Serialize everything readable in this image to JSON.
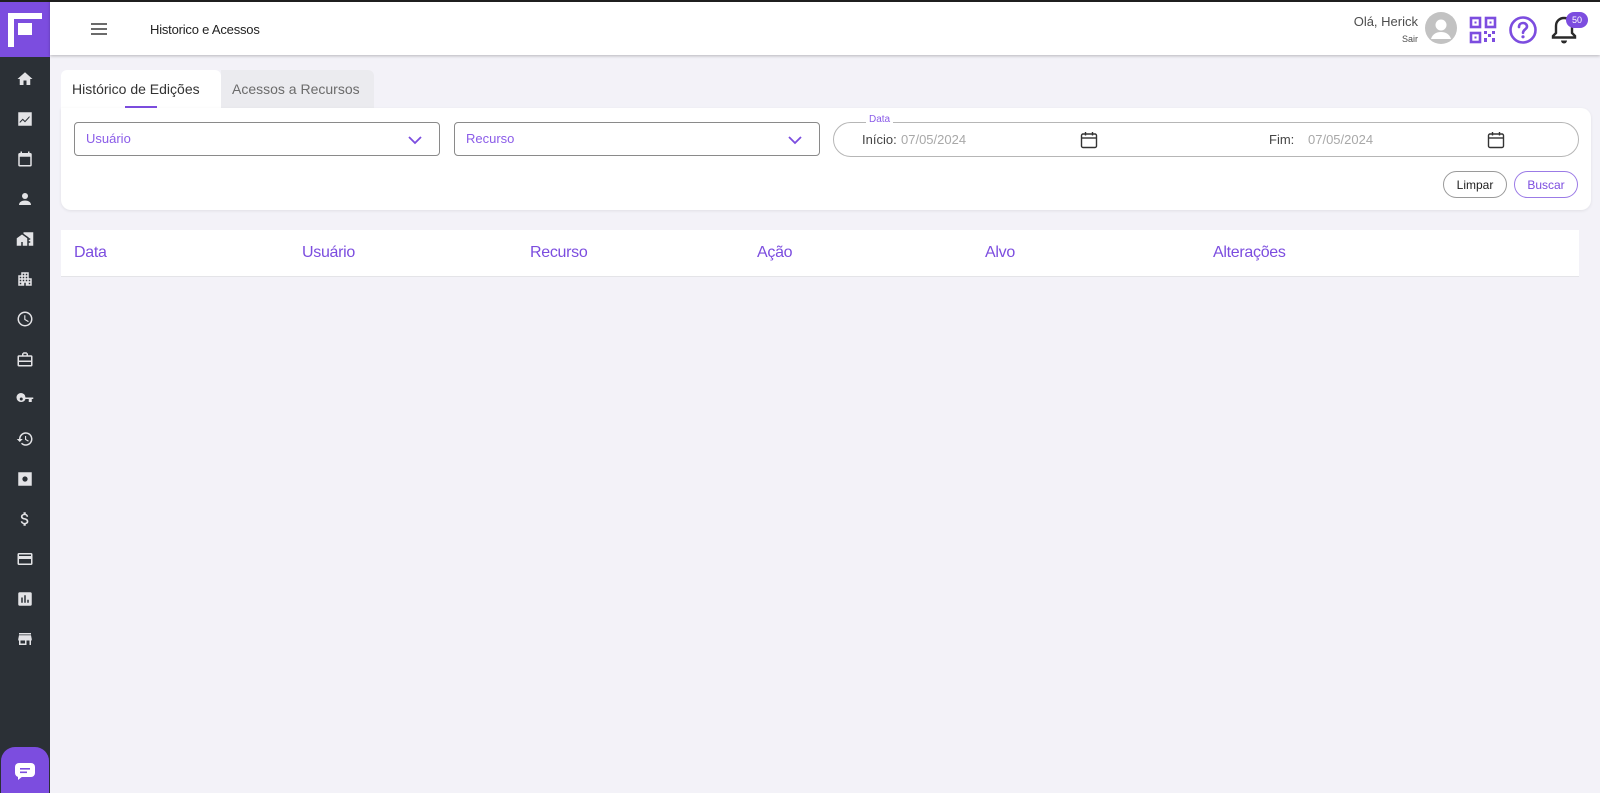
{
  "header": {
    "title": "Historico e Acessos",
    "greeting": "Olá, Herick",
    "logout": "Sair",
    "notification_count": "50"
  },
  "sidebar": {
    "items": [
      {
        "icon": "home-icon"
      },
      {
        "icon": "trending-icon"
      },
      {
        "icon": "calendar-icon"
      },
      {
        "icon": "person-icon"
      },
      {
        "icon": "building-icon"
      },
      {
        "icon": "apartment-icon"
      },
      {
        "icon": "clock-icon"
      },
      {
        "icon": "briefcase-icon"
      },
      {
        "icon": "key-icon"
      },
      {
        "icon": "history-icon"
      },
      {
        "icon": "settings-icon"
      },
      {
        "icon": "dollar-icon"
      },
      {
        "icon": "card-icon"
      },
      {
        "icon": "report-icon"
      },
      {
        "icon": "store-icon"
      }
    ]
  },
  "tabs": [
    {
      "label": "Histórico de Edições",
      "active": true
    },
    {
      "label": "Acessos a Recursos",
      "active": false
    }
  ],
  "filters": {
    "user_placeholder": "Usuário",
    "resource_placeholder": "Recurso",
    "date_legend": "Data",
    "start_label": "Início:",
    "start_value": "07/05/2024",
    "end_label": "Fim:",
    "end_value": "07/05/2024",
    "clear_label": "Limpar",
    "search_label": "Buscar"
  },
  "table": {
    "columns": [
      "Data",
      "Usuário",
      "Recurso",
      "Ação",
      "Alvo",
      "Alterações"
    ],
    "rows": []
  },
  "colors": {
    "accent": "#7c4ddf",
    "sidebar": "#2b3036",
    "background": "#f3f2f8"
  }
}
